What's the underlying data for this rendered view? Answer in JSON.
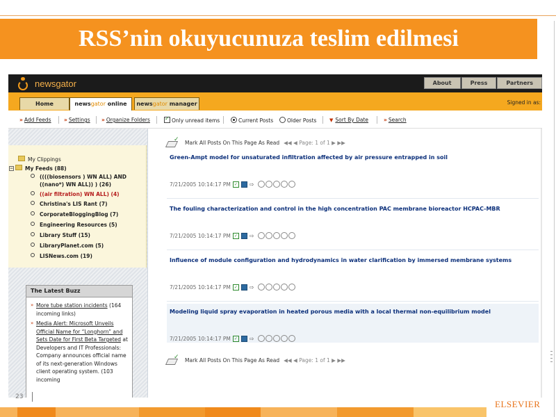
{
  "slide": {
    "title": "RSS’nin okuyucunuza teslim edilmesi",
    "number": "23",
    "publisher": "ELSEVIER",
    "colors": {
      "title_bar": "#f5921f",
      "footer_orange": "#f08a1c",
      "footer_light": "#f7b35a"
    }
  },
  "app": {
    "logo_text": "newsgator",
    "top_links": [
      "About",
      "Press",
      "Partners"
    ],
    "tabs": [
      {
        "label": "Home"
      },
      {
        "label_prefix": "news",
        "label_highlight": "gator",
        "label_suffix": " online"
      },
      {
        "label_prefix": "news",
        "label_highlight": "gator",
        "label_suffix": " manager"
      }
    ],
    "signed_in": "Signed in as:"
  },
  "toolbar": {
    "add_feeds": "Add Feeds",
    "settings": "Settings",
    "organize_folders": "Organize Folders",
    "only_unread": "Only unread items",
    "current_posts": "Current Posts",
    "older_posts": "Older Posts",
    "sort_by_date": "Sort By Date",
    "search": "Search"
  },
  "sidebar": {
    "my_clippings": "My Clippings",
    "my_feeds": "My Feeds (88)",
    "feeds": [
      {
        "label_line1": "((((biosensors ) WN ALL) AND",
        "label_line2": "((nano*) WN ALL)) ) (26)"
      },
      {
        "label": "((air filtration) WN ALL) (4)"
      },
      {
        "label": "Christina's LIS Rant (7)"
      },
      {
        "label": "CorporateBloggingBlog (7)"
      },
      {
        "label": "Engineering Resources (5)"
      },
      {
        "label": "Library Stuff (15)"
      },
      {
        "label": "LibraryPlanet.com (5)"
      },
      {
        "label": "LISNews.com (19)"
      }
    ]
  },
  "buzz": {
    "heading": "The Latest Buzz",
    "items": [
      {
        "link": "More tube station incidents",
        "text": " (164 incoming links)"
      },
      {
        "link": "Media Alert: Microsoft Unveils Official Name for “Longhorn” and Sets Date for First Beta Targeted",
        "text": " at Developers and IT Professionals: Company announces official name of its next-generation Windows client operating system. (103 incoming"
      }
    ]
  },
  "main": {
    "mark_all": "Mark All Posts On This Page As Read",
    "page": "Page: 1 of 1",
    "posts": [
      {
        "title": "Green-Ampt model for unsaturated infiltration affected by air pressure entrapped in soil",
        "date": "7/21/2005 10:14:17 PM"
      },
      {
        "title": "The fouling characterization and control in the high concentration PAC membrane bioreactor HCPAC-MBR",
        "date": "7/21/2005 10:14:17 PM"
      },
      {
        "title": "Influence of module configuration and hydrodynamics in water clarification by immersed membrane systems",
        "date": "7/21/2005 10:14:17 PM"
      },
      {
        "title": "Modeling liquid spray evaporation in heated porous media with a local thermal non-equilibrium model",
        "date": "7/21/2005 10:14:17 PM"
      }
    ]
  }
}
